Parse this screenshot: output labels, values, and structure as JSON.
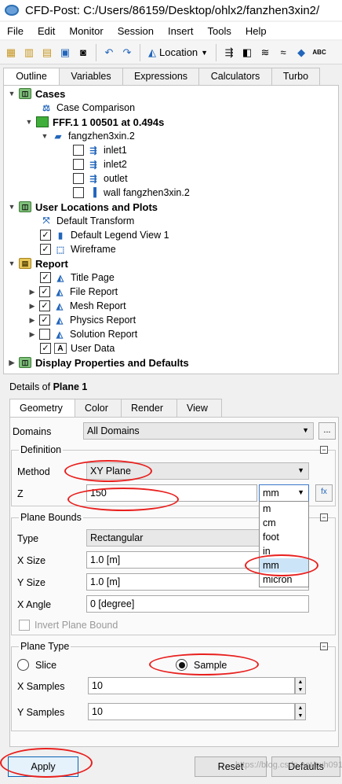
{
  "window": {
    "title": "CFD-Post: C:/Users/86159/Desktop/ohlx2/fanzhen3xin2/"
  },
  "menu": [
    "File",
    "Edit",
    "Monitor",
    "Session",
    "Insert",
    "Tools",
    "Help"
  ],
  "toolbar": {
    "location_label": "Location",
    "abc_label": "ABC"
  },
  "tabs": [
    "Outline",
    "Variables",
    "Expressions",
    "Calculators",
    "Turbo"
  ],
  "tree": {
    "cases": "Cases",
    "case_comparison": "Case Comparison",
    "case_file": "FFF.1 1 00501 at 0.494s",
    "domain": "fangzhen3xin.2",
    "inlet1": "inlet1",
    "inlet2": "inlet2",
    "outlet": "outlet",
    "wall": "wall fangzhen3xin.2",
    "user_locations": "User Locations and Plots",
    "default_transform": "Default Transform",
    "default_legend": "Default Legend View 1",
    "wireframe": "Wireframe",
    "report": "Report",
    "title_page": "Title Page",
    "file_report": "File Report",
    "mesh_report": "Mesh Report",
    "physics_report": "Physics Report",
    "solution_report": "Solution Report",
    "user_data": "User Data",
    "display_properties": "Display Properties and Defaults"
  },
  "details": {
    "prefix": "Details of ",
    "object": "Plane 1",
    "tabs": [
      "Geometry",
      "Color",
      "Render",
      "View"
    ],
    "domains_label": "Domains",
    "domains_value": "All Domains",
    "more_button": "...",
    "definition_title": "Definition",
    "method_label": "Method",
    "method_value": "XY Plane",
    "z_label": "Z",
    "z_value": "150",
    "z_unit": "mm",
    "unit_options": [
      "m",
      "cm",
      "foot",
      "in",
      "mm",
      "micron"
    ],
    "plane_bounds_title": "Plane Bounds",
    "type_label": "Type",
    "type_value": "Rectangular",
    "x_size_label": "X Size",
    "x_size_value": "1.0 [m]",
    "y_size_label": "Y Size",
    "y_size_value": "1.0 [m]",
    "x_angle_label": "X Angle",
    "x_angle_value": "0 [degree]",
    "invert_label": "Invert Plane Bound",
    "plane_type_title": "Plane Type",
    "slice_label": "Slice",
    "sample_label": "Sample",
    "x_samples_label": "X Samples",
    "x_samples_value": "10",
    "y_samples_label": "Y Samples",
    "y_samples_value": "10"
  },
  "buttons": {
    "apply": "Apply",
    "reset": "Reset",
    "defaults": "Defaults"
  },
  "watermark": "https://blog.csdn.net/cxh0919",
  "colors": {
    "annotation": "#e8201e",
    "selection": "#cce4f7"
  }
}
